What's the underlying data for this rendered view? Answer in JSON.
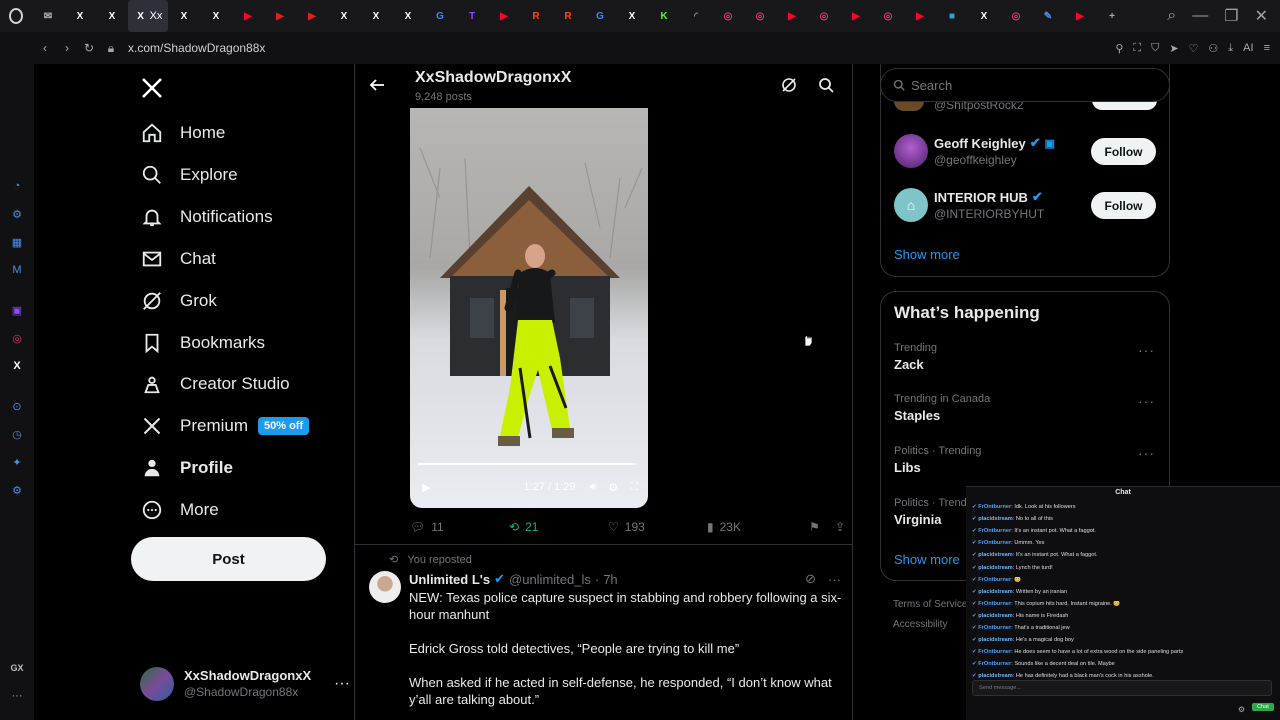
{
  "browser": {
    "active_tab_title": "Xx",
    "url": "x.com/ShadowDragon88x",
    "ai_label": "AI",
    "gx_label": "GX",
    "tabs": [
      {
        "icon": "mail-icon",
        "color": "#bbbbbb",
        "glyph": "✉"
      },
      {
        "icon": "x-logo-icon",
        "color": "#ffffff",
        "glyph": "X"
      },
      {
        "icon": "x-logo-icon",
        "color": "#ffffff",
        "glyph": "X"
      },
      {
        "icon": "x-logo-icon",
        "color": "#ffffff",
        "glyph": "X",
        "active": true
      },
      {
        "icon": "x-logo-icon",
        "color": "#ffffff",
        "glyph": "X"
      },
      {
        "icon": "x-logo-icon",
        "color": "#ffffff",
        "glyph": "X"
      },
      {
        "icon": "youtube-icon",
        "color": "#ff0033",
        "glyph": "▶"
      },
      {
        "icon": "play-icon",
        "color": "#e02020",
        "glyph": "▶"
      },
      {
        "icon": "play-icon",
        "color": "#e02020",
        "glyph": "▶"
      },
      {
        "icon": "x-logo-icon",
        "color": "#ffffff",
        "glyph": "X"
      },
      {
        "icon": "x-logo-icon",
        "color": "#ffffff",
        "glyph": "X"
      },
      {
        "icon": "x-logo-icon",
        "color": "#ffffff",
        "glyph": "X"
      },
      {
        "icon": "google-icon",
        "color": "#4285f4",
        "glyph": "G"
      },
      {
        "icon": "twitch-icon",
        "color": "#9146ff",
        "glyph": "T"
      },
      {
        "icon": "youtube-icon",
        "color": "#ff0033",
        "glyph": "▶"
      },
      {
        "icon": "reddit-icon",
        "color": "#ff4500",
        "glyph": "R"
      },
      {
        "icon": "reddit-icon",
        "color": "#ff4500",
        "glyph": "R"
      },
      {
        "icon": "google-icon",
        "color": "#4285f4",
        "glyph": "G"
      },
      {
        "icon": "x-logo-icon",
        "color": "#ffffff",
        "glyph": "X"
      },
      {
        "icon": "kick-icon",
        "color": "#53fc18",
        "glyph": "K"
      },
      {
        "icon": "loading-icon",
        "color": "#888888",
        "glyph": "◜"
      },
      {
        "icon": "instagram-icon",
        "color": "#e1306c",
        "glyph": "◎"
      },
      {
        "icon": "instagram-icon",
        "color": "#e1306c",
        "glyph": "◎"
      },
      {
        "icon": "youtube-icon",
        "color": "#ff0033",
        "glyph": "▶"
      },
      {
        "icon": "instagram-icon",
        "color": "#e1306c",
        "glyph": "◎"
      },
      {
        "icon": "youtube-icon",
        "color": "#ff0033",
        "glyph": "▶"
      },
      {
        "icon": "instagram-icon",
        "color": "#e1306c",
        "glyph": "◎"
      },
      {
        "icon": "youtube-icon",
        "color": "#ff0033",
        "glyph": "▶"
      },
      {
        "icon": "site-icon",
        "color": "#3aa0d8",
        "glyph": "■"
      },
      {
        "icon": "x-logo-icon",
        "color": "#ffffff",
        "glyph": "X"
      },
      {
        "icon": "instagram-icon",
        "color": "#e1306c",
        "glyph": "◎"
      },
      {
        "icon": "edit-icon",
        "color": "#4a8af4",
        "glyph": "✎"
      },
      {
        "icon": "youtube-icon",
        "color": "#ff0033",
        "glyph": "▶"
      },
      {
        "icon": "new-tab-icon",
        "color": "#aaaaaa",
        "glyph": "+"
      }
    ]
  },
  "nav": {
    "items": [
      {
        "name": "home",
        "label": "Home",
        "icon": "home-icon"
      },
      {
        "name": "explore",
        "label": "Explore",
        "icon": "search-icon"
      },
      {
        "name": "notifications",
        "label": "Notifications",
        "icon": "bell-icon"
      },
      {
        "name": "chat",
        "label": "Chat",
        "icon": "mail-icon"
      },
      {
        "name": "grok",
        "label": "Grok",
        "icon": "grok-icon"
      },
      {
        "name": "bookmarks",
        "label": "Bookmarks",
        "icon": "bookmark-icon"
      },
      {
        "name": "creator-studio",
        "label": "Creator Studio",
        "icon": "creator-icon"
      },
      {
        "name": "premium",
        "label": "Premium",
        "icon": "x-logo-icon",
        "badge": "50% off"
      },
      {
        "name": "profile",
        "label": "Profile",
        "icon": "person-icon",
        "bold": true
      },
      {
        "name": "more",
        "label": "More",
        "icon": "more-circle-icon"
      }
    ],
    "post_label": "Post",
    "account": {
      "name": "XxShadowDragonxX",
      "handle": "@ShadowDragon88x"
    }
  },
  "profile_header": {
    "name": "XxShadowDragonxX",
    "posts": "9,248 posts"
  },
  "video": {
    "time": "1:27 / 1:29",
    "progress": 0.98
  },
  "post_actions": {
    "replies": "11",
    "reposts": "21",
    "likes": "193",
    "views": "23K"
  },
  "post2": {
    "repost_label": "You reposted",
    "author": "Unlimited L's",
    "handle": "@unlimited_ls",
    "age": "7h",
    "paragraphs": [
      "NEW: Texas police capture suspect in stabbing and robbery following a six-hour manhunt",
      "Edrick Gross told detectives, “People are trying to kill me”",
      "When asked if he acted in  self-defense, he responded, “I don’t know what y’all are talking  about.”"
    ]
  },
  "search": {
    "placeholder": "Search"
  },
  "who_to_follow": {
    "partial_handle": "@ShitpostRock2",
    "users": [
      {
        "name": "Geoff Keighley",
        "handle": "@geoffkeighley",
        "button": "Follow"
      },
      {
        "name": "INTERIOR HUB",
        "handle": "@INTERIORBYHUT",
        "button": "Follow"
      }
    ],
    "show_more": "Show more"
  },
  "happening": {
    "title": "What’s happening",
    "trends": [
      {
        "context": "Trending",
        "topic": "Zack"
      },
      {
        "context": "Trending in Canada",
        "topic": "Staples"
      },
      {
        "context": "Politics · Trending",
        "topic": "Libs"
      },
      {
        "context": "Politics · Trend",
        "topic": "Virginia"
      }
    ],
    "show_more": "Show more"
  },
  "footer": {
    "terms": "Terms of Service",
    "accessibility": "Accessibility"
  },
  "chat_overlay": {
    "title": "Chat",
    "placeholder": "Send message...",
    "send_label": "Chat",
    "messages": [
      {
        "user": "FrOntburner",
        "text": "Idk. Look at his followers",
        "color": "#4aa3ff"
      },
      {
        "user": "placidstream",
        "text": "No to all of this",
        "color": "#6fb6ff"
      },
      {
        "user": "FrOntburner",
        "text": "It's an instant pot. What a faggot.",
        "color": "#4aa3ff"
      },
      {
        "user": "FrOntburner",
        "text": "Ummm. Yes",
        "color": "#4aa3ff"
      },
      {
        "user": "placidstream",
        "text": "It's an instant pot. What a faggot.",
        "color": "#6fb6ff"
      },
      {
        "user": "placidstream",
        "text": "Lynch the turd!",
        "color": "#6fb6ff"
      },
      {
        "user": "FrOntburner",
        "text": "😊",
        "color": "#4aa3ff"
      },
      {
        "user": "placidstream",
        "text": "Written by an iranian",
        "color": "#6fb6ff"
      },
      {
        "user": "FrOntburner",
        "text": "This copium hits hard. Instant migraine. 😊",
        "color": "#4aa3ff"
      },
      {
        "user": "placidstream",
        "text": "His name is Firedash",
        "color": "#6fb6ff"
      },
      {
        "user": "FrOntburner",
        "text": "That's a traditional jew",
        "color": "#4aa3ff"
      },
      {
        "user": "placidstream",
        "text": "He's a magical dog boy",
        "color": "#6fb6ff"
      },
      {
        "user": "FrOntburner",
        "text": "He does seem to have a lot of extra wood on the side paneling parts",
        "color": "#4aa3ff"
      },
      {
        "user": "FrOntburner",
        "text": "Sounds like a decent deal on tile. Maybe",
        "color": "#4aa3ff"
      },
      {
        "user": "placidstream",
        "text": "He has definitely had a black man's cock in his asshole.",
        "color": "#6fb6ff"
      }
    ]
  }
}
